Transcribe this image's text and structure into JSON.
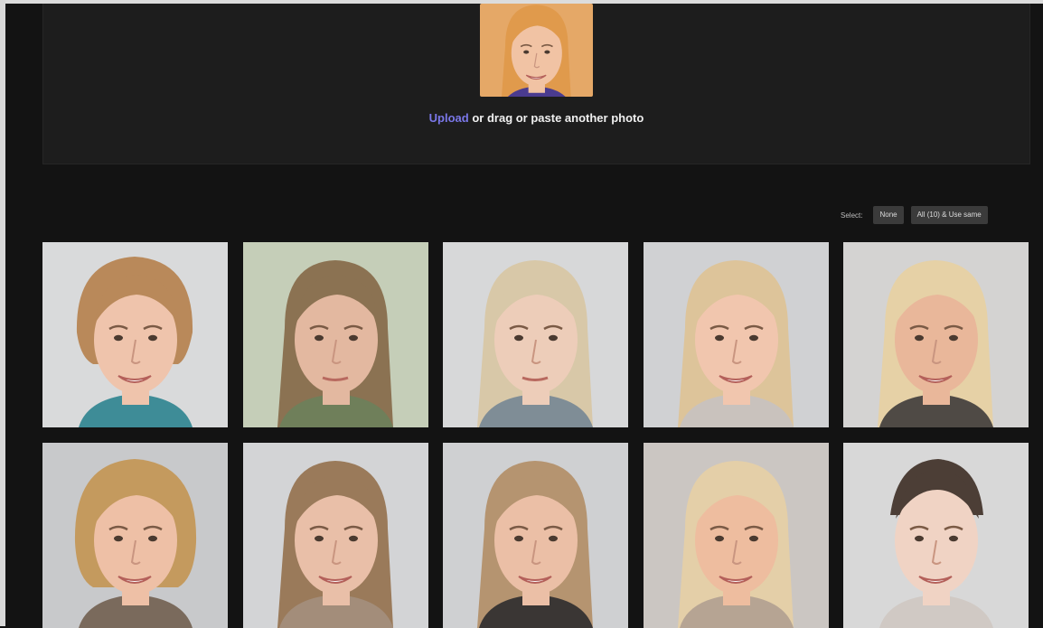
{
  "upload": {
    "link_text": "Upload",
    "rest_text": " or drag or paste another photo",
    "thumbnail": {
      "background": "#e5a867",
      "hair": "#e09a4c",
      "skin": "#f1c3a4",
      "shirt": "#4a3b8f",
      "icon": "uploaded-face-photo"
    }
  },
  "toolbar": {
    "label": "Select:",
    "buttons": [
      "None",
      "All (10) & Use same"
    ]
  },
  "faces": [
    {
      "bg": "#d9dadb",
      "hair": "#b9895a",
      "skin": "#efc4ac",
      "shirt": "#3e8c97",
      "hair_style": "short",
      "smile": true
    },
    {
      "bg": "#c5ceb8",
      "hair": "#8b7252",
      "skin": "#e3b8a0",
      "shirt": "#6f7f5a",
      "hair_style": "long",
      "smile": false
    },
    {
      "bg": "#d7d8d9",
      "hair": "#d8c8a8",
      "skin": "#edcdb9",
      "shirt": "#7f8d96",
      "hair_style": "long",
      "smile": false
    },
    {
      "bg": "#d0d1d3",
      "hair": "#ddc49a",
      "skin": "#f1c6ae",
      "shirt": "#c9c2bd",
      "hair_style": "long",
      "smile": true
    },
    {
      "bg": "#d4d3d2",
      "hair": "#e6d1a6",
      "skin": "#e9b79a",
      "shirt": "#4f4a45",
      "hair_style": "long",
      "smile": true
    },
    {
      "bg": "#c8c9cb",
      "hair": "#c49a5e",
      "skin": "#eec0a6",
      "shirt": "#7a6a5c",
      "hair_style": "bob",
      "smile": true
    },
    {
      "bg": "#d3d4d6",
      "hair": "#9a7a5a",
      "skin": "#e9bfa8",
      "shirt": "#a38d7a",
      "hair_style": "long",
      "smile": true
    },
    {
      "bg": "#cfd0d2",
      "hair": "#b59470",
      "skin": "#ebbfa6",
      "shirt": "#3a3634",
      "hair_style": "long",
      "smile": true
    },
    {
      "bg": "#cbc6c2",
      "hair": "#e4cfa8",
      "skin": "#eebd9f",
      "shirt": "#b6a493",
      "hair_style": "long",
      "smile": true
    },
    {
      "bg": "#d8d8d8",
      "hair": "#4c3e36",
      "skin": "#f0d3c4",
      "shirt": "#d0c9c4",
      "hair_style": "updo",
      "smile": true
    }
  ]
}
